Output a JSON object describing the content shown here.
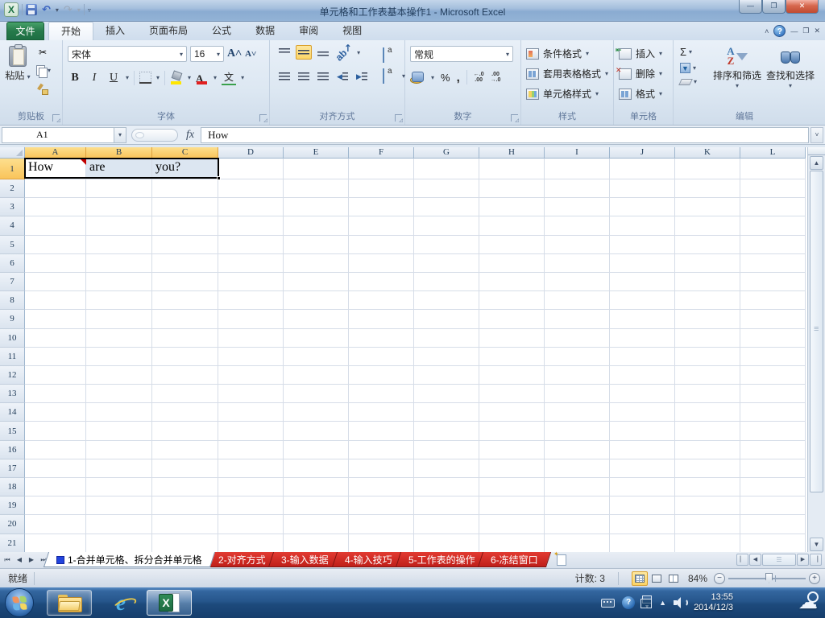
{
  "colors": {
    "file_button_green": "#1e7145",
    "selected_header_amber": "#f9c45b",
    "selection_fill_blue": "#dce6f1",
    "sheet_tab_red": "#c01f1a",
    "highlight_orange": "#fbd467",
    "taskbar_blue": "#26568c",
    "comment_indicator_red": "#c00000"
  },
  "title_bar": {
    "title": "单元格和工作表基本操作1 - Microsoft Excel",
    "minimize": "—",
    "maximize": "❐",
    "close": "✕"
  },
  "ribbon": {
    "file_label": "文件",
    "tabs": [
      "开始",
      "插入",
      "页面布局",
      "公式",
      "数据",
      "审阅",
      "视图"
    ],
    "active_tab": "开始",
    "minimize_ribbon": "˄",
    "help": "?",
    "win_min": "—",
    "win_restore": "❐",
    "win_close": "✕",
    "clipboard": {
      "label": "剪贴板",
      "paste": "粘贴",
      "cut_glyph": "✂"
    },
    "font": {
      "label": "字体",
      "family": "宋体",
      "size": "16",
      "bold": "B",
      "italic": "I",
      "underline": "U",
      "grow": "A",
      "shrink": "A",
      "phonetic": "文"
    },
    "alignment": {
      "label": "对齐方式",
      "orient_glyph": "ab"
    },
    "number": {
      "label": "数字",
      "format": "常规",
      "percent": "%",
      "comma": ",",
      "inc_dec_top": "←.0",
      "inc_dec_bot": ".00",
      "dec_dec_top": ".00",
      "dec_dec_bot": "→.0"
    },
    "styles": {
      "label": "样式",
      "items": [
        "条件格式",
        "套用表格格式",
        "单元格样式"
      ]
    },
    "cells": {
      "label": "单元格",
      "items": [
        "插入",
        "删除",
        "格式"
      ],
      "marks": [
        "+",
        "✕",
        ""
      ]
    },
    "editing": {
      "label": "编辑",
      "sigma": "Σ",
      "az_top": "A",
      "az_bot": "Z",
      "sort_filter": "排序和筛选",
      "find_select": "查找和选择"
    }
  },
  "formula_bar": {
    "name_box": "A1",
    "fx": "fx",
    "value": "How"
  },
  "grid": {
    "columns": [
      "A",
      "B",
      "C",
      "D",
      "E",
      "F",
      "G",
      "H",
      "I",
      "J",
      "K",
      "L"
    ],
    "selected_columns": [
      "A",
      "B",
      "C"
    ],
    "row_count": 21,
    "selected_rows": [
      1
    ],
    "cells": [
      {
        "col": "A",
        "row": 1,
        "text": "How",
        "active": true,
        "comment": true
      },
      {
        "col": "B",
        "row": 1,
        "text": "are",
        "selected": true
      },
      {
        "col": "C",
        "row": 1,
        "text": "you?",
        "selected": true
      }
    ]
  },
  "sheet_bar": {
    "nav": [
      "⏮",
      "◀",
      "▶",
      "⏭"
    ],
    "tabs": [
      {
        "label": "1-合并单元格、拆分合并单元格",
        "active": true,
        "color_square": true
      },
      {
        "label": "2-对齐方式",
        "active": false
      },
      {
        "label": "3-输入数据",
        "active": false
      },
      {
        "label": "4-输入技巧",
        "active": false
      },
      {
        "label": "5-工作表的操作",
        "active": false
      },
      {
        "label": "6-冻结窗口",
        "active": false
      }
    ]
  },
  "status_bar": {
    "mode": "就绪",
    "count": "计数: 3",
    "zoom": "84%",
    "zoom_out": "−",
    "zoom_in": "+"
  },
  "taskbar": {
    "time": "13:55",
    "date": "2014/12/3"
  }
}
